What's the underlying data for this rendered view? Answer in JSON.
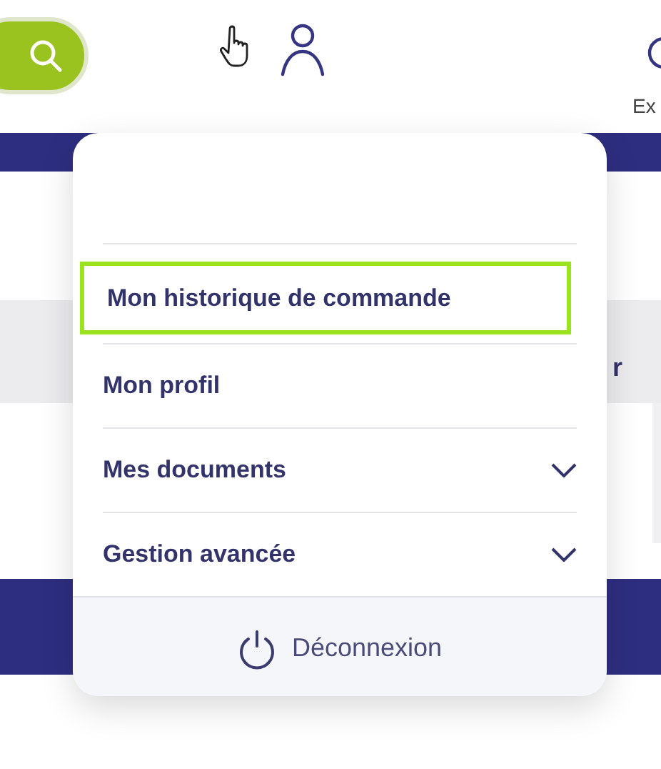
{
  "header": {
    "partial_label": "Ex"
  },
  "page": {
    "partial_text": "r"
  },
  "account_menu": {
    "items": [
      {
        "label": "Mon historique de commande",
        "kind": "link",
        "selected": true
      },
      {
        "label": "Mon profil",
        "kind": "link",
        "selected": false
      },
      {
        "label": "Mes documents",
        "kind": "expandable",
        "selected": false
      },
      {
        "label": "Gestion avancée",
        "kind": "expandable",
        "selected": false
      }
    ],
    "logout": {
      "label": "Déconnexion"
    }
  }
}
